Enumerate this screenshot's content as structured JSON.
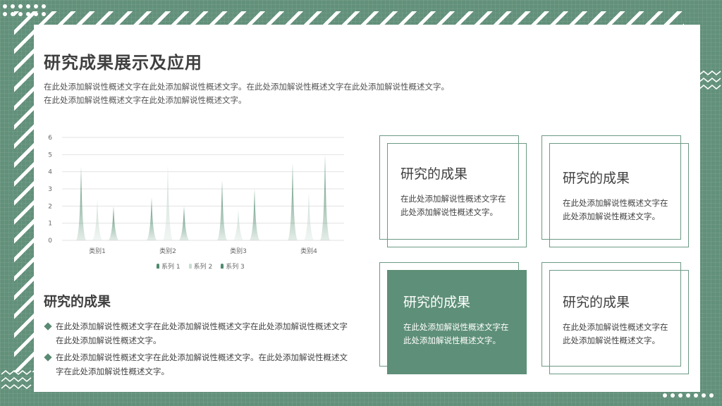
{
  "slide": {
    "title": "研究成果展示及应用",
    "desc_line1": "在此处添加解说性概述文字在此处添加解说性概述文字。在此处添加解说性概述文字在此处添加解说性概述文字。",
    "desc_line2": "在此处添加解说性概述文字在此处添加解说性概述文字。"
  },
  "chart_data": {
    "type": "area",
    "categories": [
      "类别1",
      "类别2",
      "类别3",
      "类别4"
    ],
    "series": [
      {
        "name": "系列 1",
        "values": [
          4.3,
          2.5,
          3.5,
          4.5
        ],
        "color": "#4f8a6d"
      },
      {
        "name": "系列 2",
        "values": [
          2.4,
          4.4,
          1.8,
          2.8
        ],
        "color": "#c8dcd2"
      },
      {
        "name": "系列 3",
        "values": [
          2.0,
          2.0,
          3.0,
          5.0
        ],
        "color": "#4f8a6d"
      }
    ],
    "ylim": [
      0,
      6
    ],
    "yticks": [
      "0",
      "1",
      "2",
      "3",
      "4",
      "5",
      "6"
    ],
    "grid": true,
    "legend_position": "bottom"
  },
  "left_section": {
    "title": "研究的成果",
    "bullets": [
      "在此处添加解说性概述文字在此处添加解说性概述文字在此处添加解说性概述文字在此处添加解说性概述文字。",
      "在此处添加解说性概述文字在此处添加解说性概述文字。在此处添加解说性概述文字在此处添加解说性概述文字。"
    ]
  },
  "boxes": [
    {
      "title": "研究的成果",
      "text": "在此处添加解说性概述文字在此处添加解说性概述文字。"
    },
    {
      "title": "研究的成果",
      "text": "在此处添加解说性概述文字在此处添加解说性概述文字。"
    },
    {
      "title": "研究的成果",
      "text": "在此处添加解说性概述文字在此处添加解说性概述文字。"
    },
    {
      "title": "研究的成果",
      "text": "在此处添加解说性概述文字在此处添加解说性概述文字。"
    }
  ],
  "colors": {
    "background": "#62907a",
    "accent": "#5e8f78",
    "card": "#ffffff"
  }
}
